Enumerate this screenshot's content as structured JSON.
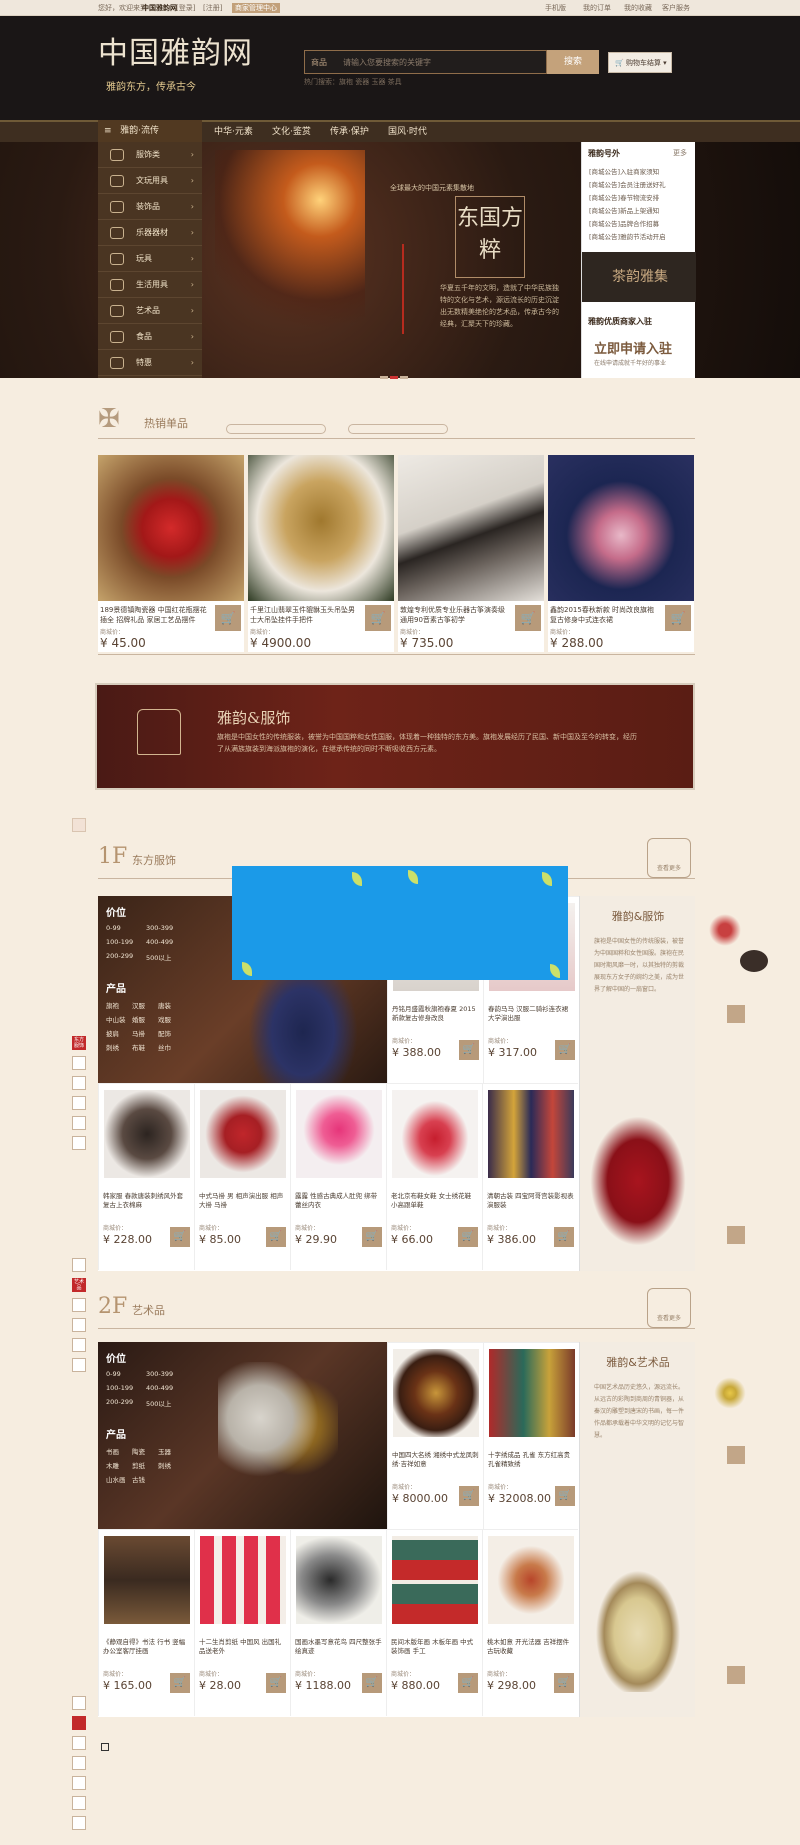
{
  "topbar": {
    "welcome": "您好，欢迎来到",
    "site": "中国雅韵网",
    "login": "[登录]",
    "register": "[注册]",
    "merchant": "商家管理中心",
    "links": [
      "手机版",
      "我的订单",
      "我的收藏",
      "客户服务"
    ]
  },
  "header": {
    "logo": "中国雅韵网",
    "slogan": "雅韵东方，传承古今",
    "search": {
      "category": "商品",
      "placeholder": "请输入您要搜索的关键字",
      "button": "搜索"
    },
    "cart": "购物车结算",
    "hot_words": "热门搜索：旗袍  瓷器  玉器  茶具"
  },
  "nav": {
    "category": "雅韵·流传",
    "items": [
      "中华·元素",
      "文化·鉴赏",
      "传承·保护",
      "国风·时代"
    ]
  },
  "sidebar": [
    "服饰类",
    "文玩用具",
    "装饰品",
    "乐器器材",
    "玩具",
    "生活用具",
    "艺术品",
    "食品",
    "特惠"
  ],
  "banner": {
    "small": "全球最大的中国元素集散地",
    "title": "东国方粹",
    "text": "华夏五千年的文明，造就了中华民族独特的文化与艺术，源远流长的历史沉淀出无数精美绝伦的艺术品，传承古今的经典，汇聚天下的珍藏。"
  },
  "news": {
    "title": "雅韵号外",
    "more": "更多",
    "items": [
      "[商城公告]入驻商家须知",
      "[商城公告]会员注册送好礼",
      "[商城公告]春节物流安排",
      "[商城公告]新品上架通知",
      "[商城公告]品牌合作招募",
      "[商城公告]雅韵节活动开启"
    ],
    "tea": "茶韵雅集",
    "apply_title": "雅韵优质商家入驻",
    "apply": "立即申请入驻",
    "apply_sub": "在线申请成就千年好的事业"
  },
  "hot": {
    "title": "热销单品",
    "products": [
      {
        "name": "189景德镇陶瓷器 中国红花瓶摆花 插全 招牌礼品 家居工艺品摆件",
        "price_label": "商城价：",
        "price": "¥ 45.00"
      },
      {
        "name": "千里江山翡翠玉件貔貅玉头吊坠男士大吊坠挂件手把件",
        "price_label": "商城价：",
        "price": "¥ 4900.00"
      },
      {
        "name": "敦煌专利优质专业乐器古筝演奏级 通用90音素古筝初学",
        "price_label": "商城价：",
        "price": "¥ 735.00"
      },
      {
        "name": "鑫韵2015春秋新款 时尚改良旗袍 复古修身中式连衣裙",
        "price_label": "商城价：",
        "price": "¥ 288.00"
      }
    ]
  },
  "promo": {
    "title": "雅韵&服饰",
    "text": "旗袍是中国女性的传统服装，被誉为中国国粹和女性国服，体现着一种独特的东方美。旗袍发展经历了民国、新中国及至今的转变，经历了从满族旗装到海派旗袍的演化，在继承传统的同时不断吸收西方元素。"
  },
  "floor1": {
    "num": "1F",
    "title": "东方服饰",
    "emblem": "查看更多",
    "price_head": "价位",
    "prices": [
      "0-99",
      "300-399",
      "100-199",
      "400-499",
      "200-299",
      "500以上"
    ],
    "prod_head": "产品",
    "tags": [
      "旗袍",
      "汉服",
      "唐装",
      "中山装",
      "婚服",
      "戏服",
      "披肩",
      "马褂",
      "配饰",
      "刺绣",
      "布鞋",
      "丝巾"
    ],
    "side_title": "雅韵&服饰",
    "side_text": "旗袍是中国女性的传统服装，被誉为中国国粹和女性国服。旗袍在民国时期风靡一时，以其独特的剪裁展现东方女子的婉约之美，成为世界了解中国的一扇窗口。",
    "top": [
      {
        "name": "丹铭月盛霞秋旗袍春夏 2015新款复古修身改良",
        "price_label": "商城价：",
        "price": "¥ 388.00"
      },
      {
        "name": "春韵马马 汉服二骑衫连衣裙 大学演出服",
        "price_label": "商城价：",
        "price": "¥ 317.00"
      }
    ],
    "bottom": [
      {
        "name": "韩家服 春款唐装刺绣风外套 复古上衣棉麻",
        "price_label": "商城价：",
        "price": "¥ 228.00"
      },
      {
        "name": "中式马褂 男 相声演出服 相声大褂 马褂",
        "price_label": "商城价：",
        "price": "¥ 85.00"
      },
      {
        "name": "露露 性感古典成人肚兜 绑带蕾丝内衣",
        "price_label": "商城价：",
        "price": "¥ 29.90"
      },
      {
        "name": "老北京布鞋女鞋 女士绣花鞋 小高跟单鞋",
        "price_label": "商城价：",
        "price": "¥ 66.00"
      },
      {
        "name": "清朝古装 四宝阿哥宫装影视表演服装",
        "price_label": "商城价：",
        "price": "¥ 386.00"
      }
    ]
  },
  "floor2": {
    "num": "2F",
    "title": "艺术品",
    "emblem": "查看更多",
    "price_head": "价位",
    "prices": [
      "0-99",
      "300-399",
      "100-199",
      "400-499",
      "200-299",
      "500以上"
    ],
    "prod_head": "产品",
    "tags": [
      "书画",
      "陶瓷",
      "玉器",
      "木雕",
      "剪纸",
      "刺绣",
      "山水画",
      "古钱"
    ],
    "side_title": "雅韵&艺术品",
    "side_text": "中国艺术品历史悠久，源远流长。从远古的彩陶到商周的青铜器，从秦汉的雕塑到唐宋的书画，每一件作品都承载着中华文明的记忆与智慧。",
    "top": [
      {
        "name": "中国四大名绣 湘绣中式龙凤刺绣·吉祥如意",
        "price_label": "商城价：",
        "price": "¥ 8000.00"
      },
      {
        "name": "十字绣成品 孔雀 东方红高贵孔雀精致绣",
        "price_label": "商城价：",
        "price": "¥ 32008.00"
      }
    ],
    "bottom": [
      {
        "name": "《静观自得》书法 行书 竖幅 办公室客厅挂画",
        "price_label": "商城价：",
        "price": "¥ 165.00"
      },
      {
        "name": "十二生肖剪纸 中国风 出国礼品送老外",
        "price_label": "商城价：",
        "price": "¥ 28.00"
      },
      {
        "name": "国画水墨写意花鸟 四尺整张手绘真迹",
        "price_label": "商城价：",
        "price": "¥ 1188.00"
      },
      {
        "name": "民间木版年画 木板年画 中式装饰画 手工",
        "price_label": "商城价：",
        "price": "¥ 880.00"
      },
      {
        "name": "桃木如意 开光法器 吉祥摆件 古玩收藏",
        "price_label": "商城价：",
        "price": "¥ 298.00"
      }
    ]
  },
  "floatnav": {
    "f1": "东方服饰",
    "f2": "艺术品"
  },
  "colors": {
    "accent": "#b79a7a",
    "dark": "#1a1616",
    "red": "#c2292a",
    "bg": "#f6ede0"
  }
}
